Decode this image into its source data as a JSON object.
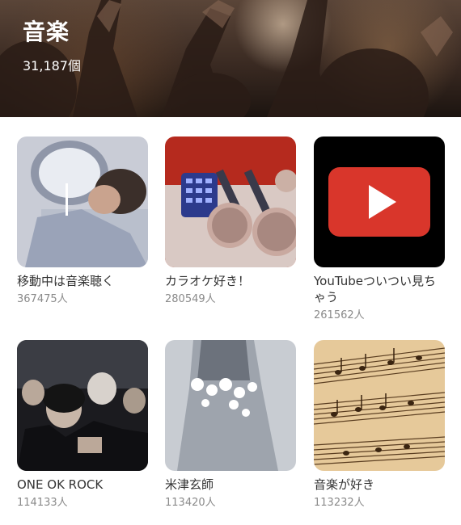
{
  "header": {
    "title": "音楽",
    "count": "31,187個"
  },
  "cards": [
    {
      "title": "移動中は音楽聴く",
      "count": "367475人",
      "image": "person-with-earphones-by-window"
    },
    {
      "title": "カラオケ好き！",
      "count": "280549人",
      "image": "karaoke-microphones"
    },
    {
      "title": "YouTubeついつい見ちゃう",
      "count": "261562人",
      "image": "youtube-logo"
    },
    {
      "title": "ONE OK ROCK",
      "count": "114133人",
      "image": "band-photo"
    },
    {
      "title": "米津玄師",
      "count": "113420人",
      "image": "flower-dress"
    },
    {
      "title": "音楽が好き",
      "count": "113232人",
      "image": "sheet-music"
    }
  ],
  "colors": {
    "youtube_red": "#d9362b",
    "card_title": "#333333",
    "card_count": "#8a8a8a"
  }
}
